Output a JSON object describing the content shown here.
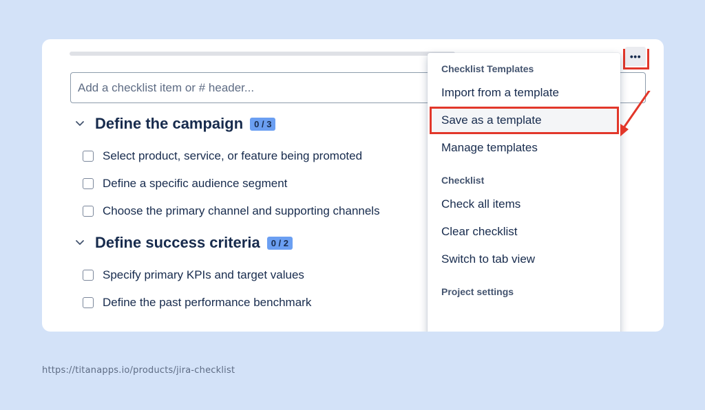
{
  "checklist": {
    "input_placeholder": "Add a checklist item or # header...",
    "sections": [
      {
        "title": "Define the campaign",
        "counter": "0 / 3",
        "items": [
          "Select product, service, or feature being promoted",
          "Define a specific audience segment",
          "Choose the primary channel and supporting channels"
        ]
      },
      {
        "title": "Define success criteria",
        "counter": "0 / 2",
        "items": [
          "Specify primary KPIs and target values",
          "Define the past performance benchmark"
        ]
      }
    ]
  },
  "more_button": {
    "icon": "more-icon",
    "label": "•••"
  },
  "menu": {
    "groups": [
      {
        "title": "Checklist Templates",
        "items": [
          "Import from a template",
          "Save as a template",
          "Manage templates"
        ]
      },
      {
        "title": "Checklist",
        "items": [
          "Check all items",
          "Clear checklist",
          "Switch to tab view"
        ]
      },
      {
        "title": "Project settings",
        "items": []
      }
    ],
    "highlighted_item": "Save as a template"
  },
  "footer": {
    "url": "https://titanapps.io/products/jira-checklist"
  },
  "colors": {
    "background": "#d3e2f8",
    "annotation": "#e2372a",
    "counter_badge": "#6b9ff2",
    "text": "#172b4d"
  }
}
